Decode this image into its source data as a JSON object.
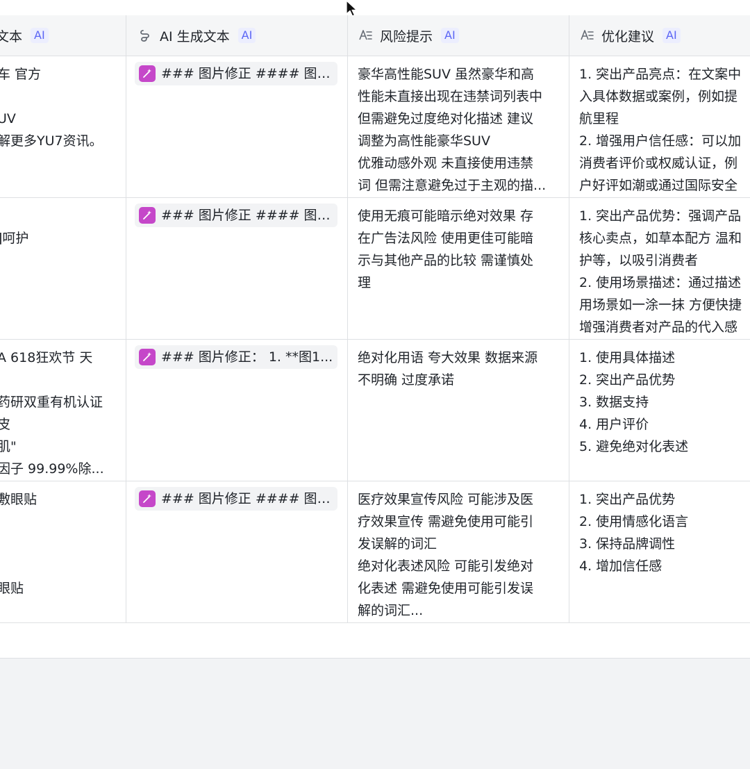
{
  "columns": [
    {
      "label": "文本",
      "badge": "AI"
    },
    {
      "label": "AI 生成文本",
      "badge": "AI",
      "icon": "ai-generate-icon"
    },
    {
      "label": "风险提示",
      "badge": "AI",
      "icon": "text-field-icon"
    },
    {
      "label": "优化建议",
      "badge": "AI",
      "icon": "text-field-icon"
    }
  ],
  "rows": [
    {
      "text": "车 官方\n\nUV\n解更多YU7资讯。",
      "ai_text": "### 图片修正 #### 图1...",
      "risk": "豪华高性能SUV 虽然豪华和高\n性能未直接出现在违禁词列表中\n但需避免过度绝对化描述 建议\n调整为高性能豪华SUV\n优雅动感外观 未直接使用违禁\n词 但需注意避免过于主观的描...",
      "suggest": "1. 突出产品亮点：在文案中\n入具体数据或案例，例如提\n航里程\n2. 增强用户信任感：可以加\n消费者评价或权威认证，例\n户好评如潮或通过国际安全"
    },
    {
      "text": "\n]呵护",
      "ai_text": "### 图片修正 #### 图1...",
      "risk": "使用无痕可能暗示绝对效果 存\n在广告法风险 使用更佳可能暗\n示与其他产品的比较 需谨慎处\n理",
      "suggest": "1. 突出产品优势：强调产品\n核心卖点，如草本配方 温和\n护等，以吸引消费者\n2. 使用场景描述：通过描述\n用场景如一涂一抹 方便快捷\n增强消费者对产品的代入感"
    },
    {
      "text": "A 618狂欢节 天\n\n药研双重有机认证\n皮\n肌\"\n因子 99.99%除...",
      "ai_text": "### 图片修正：  1. **图1...",
      "risk": "绝对化用语 夸大效果 数据来源\n不明确 过度承诺",
      "suggest": "1. 使用具体描述\n2. 突出产品优势\n3. 数据支持\n4. 用户评价\n5. 避免绝对化表述"
    },
    {
      "text": "敷眼贴\n\n\n\n眼贴",
      "ai_text": "### 图片修正 #### 图1...",
      "risk": "医疗效果宣传风险 可能涉及医\n疗效果宣传 需避免使用可能引\n发误解的词汇\n绝对化表述风险 可能引发绝对\n化表述 需避免使用可能引发误\n解的词汇...",
      "suggest": "1. 突出产品优势\n2. 使用情感化语言\n3. 保持品牌调性\n4. 增加信任感"
    }
  ],
  "colors": {
    "accent": "#5b65f5",
    "magic_chip": "#c547c9",
    "border": "#dee0e3",
    "header_bg": "#f5f6f7",
    "canvas_bg": "#f2f3f5"
  }
}
